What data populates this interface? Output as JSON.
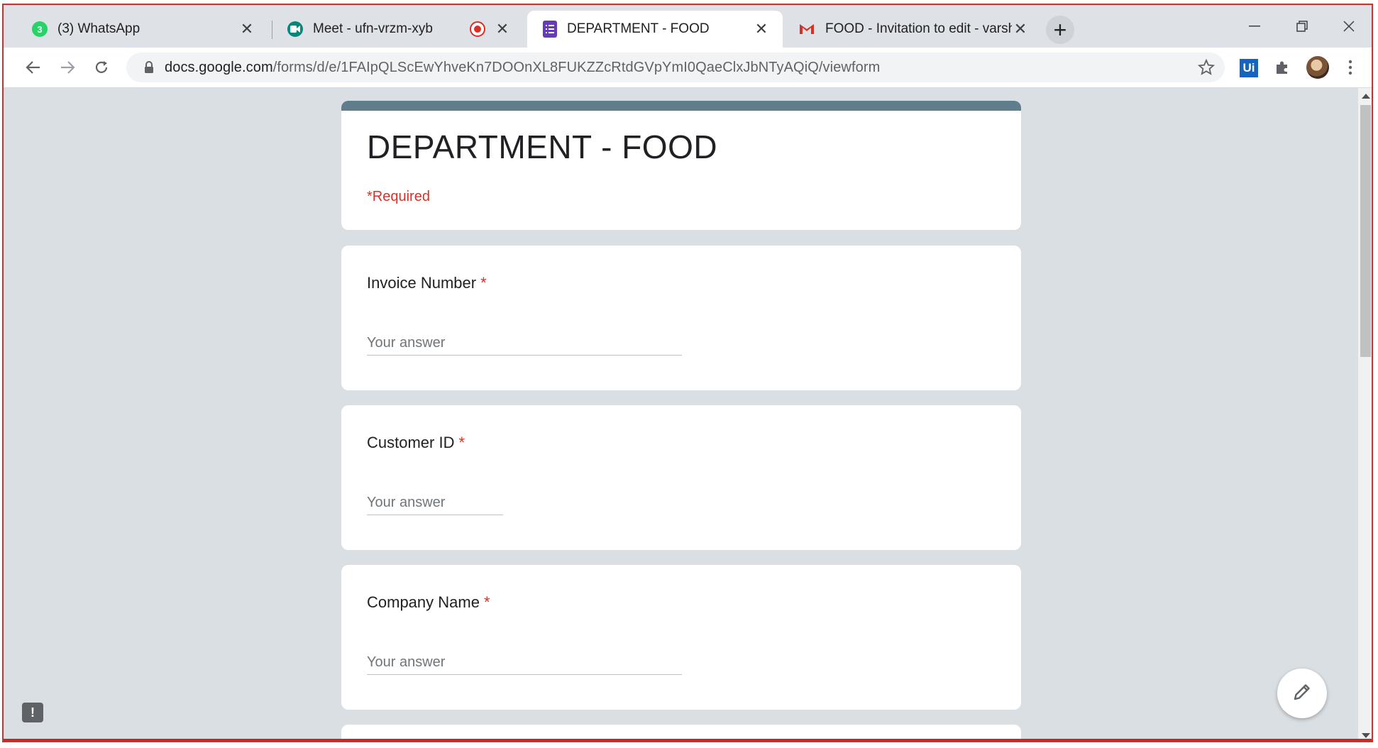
{
  "browser": {
    "tabs": [
      {
        "title": "(3) WhatsApp",
        "icon": "whatsapp-icon",
        "badge": "3"
      },
      {
        "title": "Meet - ufn-vrzm-xyb",
        "icon": "meet-icon",
        "recording": true
      },
      {
        "title": "DEPARTMENT - FOOD",
        "icon": "forms-icon",
        "active": true
      },
      {
        "title": "FOOD - Invitation to edit - varshi",
        "icon": "gmail-icon"
      }
    ],
    "new_tab": "+",
    "url_host": "docs.google.com",
    "url_path": "/forms/d/e/1FAIpQLScEwYhveKn7DOOnXL8FUKZZcRtdGVpYmI0QaeClxJbNTyAQiQ/viewform",
    "extension_label": "Ui"
  },
  "form": {
    "title": "DEPARTMENT - FOOD",
    "required_note": "*Required",
    "header_color": "#607d8b",
    "questions": [
      {
        "label": "Invoice Number",
        "required_mark": "*",
        "placeholder": "Your answer"
      },
      {
        "label": "Customer ID",
        "required_mark": "*",
        "placeholder": "Your answer"
      },
      {
        "label": "Company Name",
        "required_mark": "*",
        "placeholder": "Your answer"
      }
    ]
  },
  "feedback_label": "!"
}
